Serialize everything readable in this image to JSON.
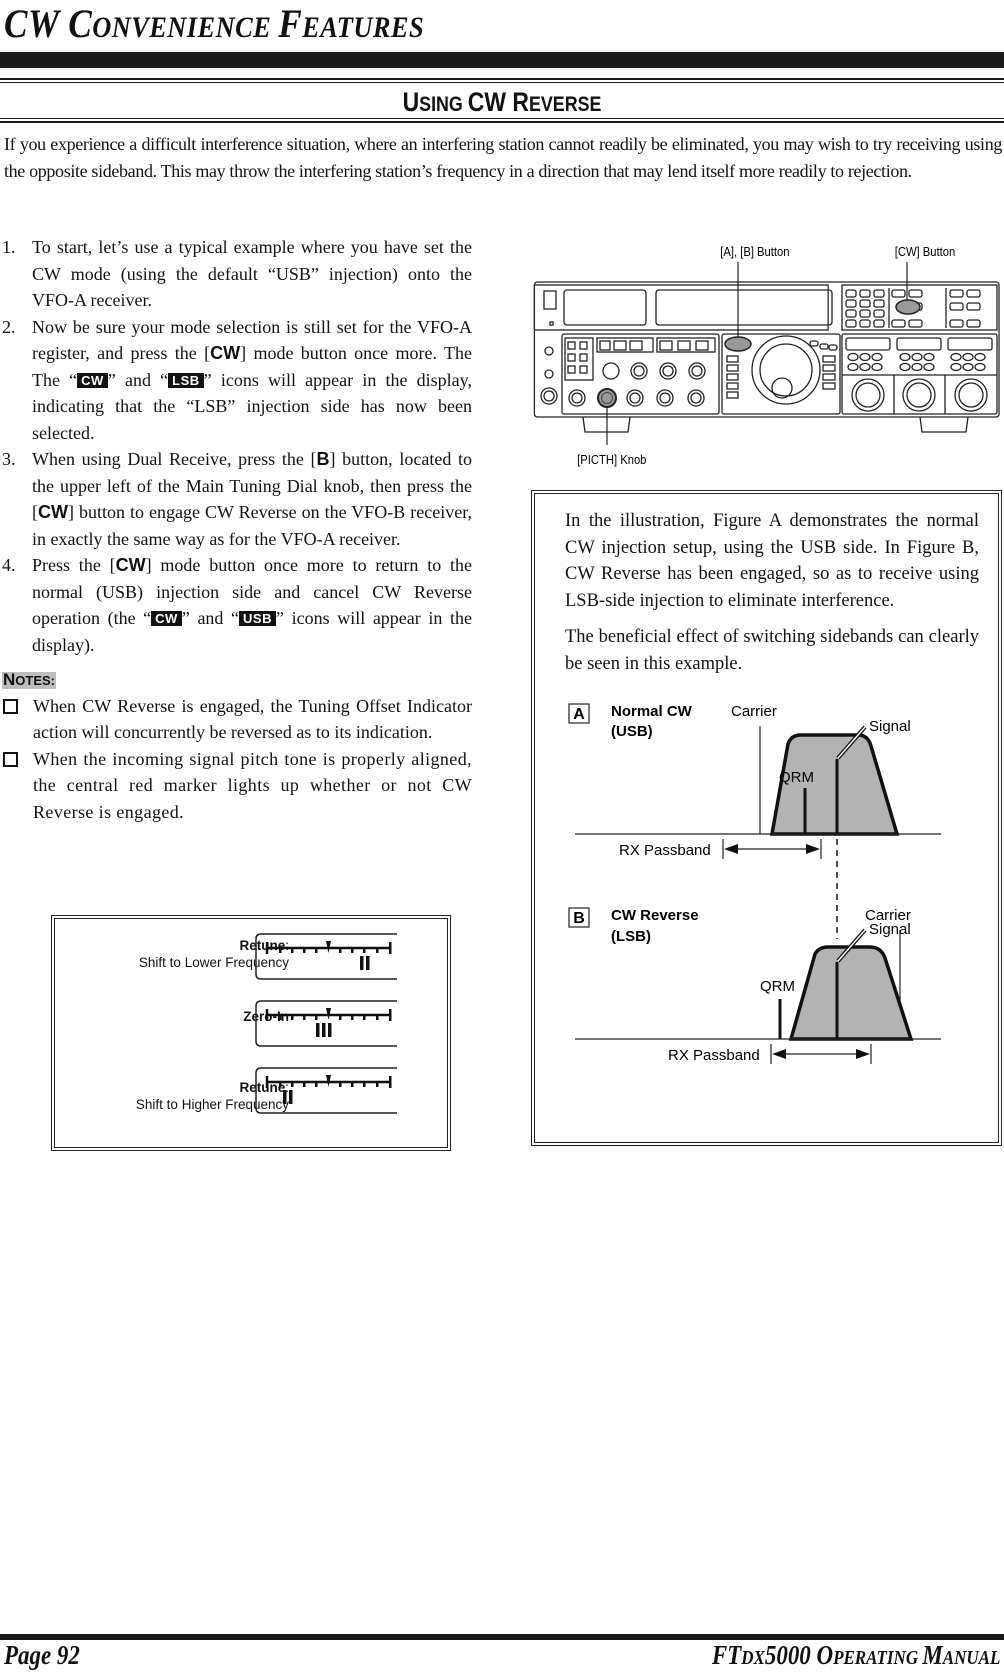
{
  "header": {
    "chapter_title_parts": [
      "CW ",
      "C",
      "ONVENIENCE ",
      "F",
      "EATURES"
    ],
    "section_title_parts": [
      "U",
      "SING ",
      "CW ",
      "R",
      "EVERSE"
    ]
  },
  "intro": "If you experience a difficult interference situation, where an interfering station cannot readily be eliminated, you may wish to try receiving using the opposite sideband. This may throw the interfering station’s frequency in a direction that may lend itself more readily to rejection.",
  "steps": [
    {
      "num": "1.",
      "parts": [
        "To start, let’s use a typical example where you have set the CW mode (using the default “USB” injection) onto the VFO-A receiver."
      ]
    },
    {
      "num": "2.",
      "parts": [
        "Now be sure your mode selection is still set for the VFO-A register, and press the [",
        "CW",
        "] mode button once more. The The “",
        "CW",
        "” and “",
        "LSB",
        "” icons will appear in the display, indicating that the “LSB” injection side has now been selected."
      ]
    },
    {
      "num": "3.",
      "parts": [
        "When using Dual Receive, press the [",
        "B",
        "] button, located to the upper left of the Main Tuning Dial knob, then press the [",
        "CW",
        "] button to engage CW Reverse on the VFO-B receiver, in exactly the same way as for the VFO-A receiver."
      ]
    },
    {
      "num": "4.",
      "parts": [
        "Press the [",
        "CW",
        "] mode button once more to return to the normal (USB) injection side and cancel CW Reverse operation (the “",
        "CW",
        "” and “",
        "USB",
        "” icons will appear in the display)."
      ]
    }
  ],
  "notes": {
    "heading_parts": [
      "N",
      "OTES:"
    ],
    "items": [
      "When CW Reverse is engaged, the Tuning Offset Indicator action will concurrently be reversed as to its indication.",
      "When the incoming signal pitch tone is properly aligned, the central red marker lights up whether or not CW Reverse is engaged."
    ]
  },
  "tuning_indicator": {
    "rows": [
      {
        "title": "Retune",
        "suffix": ":",
        "subtitle": "Shift to Lower Frequency",
        "bars": 2,
        "position": "right"
      },
      {
        "title": "Zero-In",
        "suffix": "",
        "subtitle": "",
        "bars": 3,
        "position": "center"
      },
      {
        "title": "Retune",
        "suffix": ":",
        "subtitle": "Shift to Higher Frequency",
        "bars": 2,
        "position": "left"
      }
    ]
  },
  "radio_figure": {
    "labels": {
      "ab_button": "[A], [B] Button",
      "cw_button": "[CW] Button",
      "pitch_knob": "[PICTH] Knob"
    }
  },
  "explanation": {
    "paragraphs": [
      "In the illustration, Figure A demonstrates the normal CW injection setup, using the USB side. In Figure B, CW Reverse has been engaged, so as to receive using LSB-side injection to eliminate interference.",
      "The beneficial effect of switching sidebands can clearly be seen in this example."
    ]
  },
  "diagram": {
    "A": {
      "letter": "A",
      "title": "Normal CW",
      "mode": "(USB)",
      "carrier": "Carrier",
      "signal": "Signal",
      "qrm": "QRM",
      "passband": "RX Passband"
    },
    "B": {
      "letter": "B",
      "title": "CW Reverse",
      "mode": "(LSB)",
      "carrier": "Carrier",
      "signal": "Signal",
      "qrm": "QRM",
      "passband": "RX Passband"
    },
    "fill_color": "#b3b3b3"
  },
  "footer": {
    "page": "Page 92",
    "manual_parts": [
      "FT",
      "DX",
      "5000 O",
      "PERATING ",
      "M",
      "ANUAL"
    ]
  }
}
